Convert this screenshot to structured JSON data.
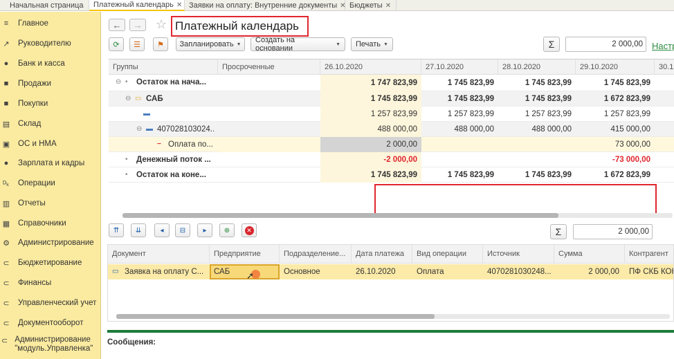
{
  "tabs": [
    {
      "label": "Начальная страница",
      "closable": false
    },
    {
      "label": "Платежный календарь",
      "closable": true
    },
    {
      "label": "Заявки на оплату: Внутренние документы",
      "closable": true
    },
    {
      "label": "Бюджеты",
      "closable": true
    }
  ],
  "sidebar": {
    "items": [
      {
        "label": "Главное",
        "icon": "menu-icon",
        "glyph": "≡"
      },
      {
        "label": "Руководителю",
        "icon": "trend-icon",
        "glyph": "↗"
      },
      {
        "label": "Банк и касса",
        "icon": "coins-icon",
        "glyph": "●"
      },
      {
        "label": "Продажи",
        "icon": "bag-icon",
        "glyph": "■"
      },
      {
        "label": "Покупки",
        "icon": "cart-icon",
        "glyph": "■"
      },
      {
        "label": "Склад",
        "icon": "warehouse-icon",
        "glyph": "▤"
      },
      {
        "label": "ОС и НМА",
        "icon": "assets-icon",
        "glyph": "▣"
      },
      {
        "label": "Зарплата и кадры",
        "icon": "people-icon",
        "glyph": "●"
      },
      {
        "label": "Операции",
        "icon": "dt-kt-icon",
        "glyph": "ᴰₖ"
      },
      {
        "label": "Отчеты",
        "icon": "bar-chart-icon",
        "glyph": "▥"
      },
      {
        "label": "Справочники",
        "icon": "book-icon",
        "glyph": "▦"
      },
      {
        "label": "Администрирование",
        "icon": "gear-icon",
        "glyph": "⚙"
      },
      {
        "label": "Бюджетирование",
        "icon": "link-icon",
        "glyph": "⊂"
      },
      {
        "label": "Финансы",
        "icon": "link-icon",
        "glyph": "⊂"
      },
      {
        "label": "Управленческий учет",
        "icon": "link-icon",
        "glyph": "⊂"
      },
      {
        "label": "Документооборот",
        "icon": "link-icon",
        "glyph": "⊂"
      },
      {
        "label": "Администрирование \"модуль.Управленка\"",
        "icon": "link-icon",
        "glyph": "⊂"
      }
    ]
  },
  "header": {
    "back": "←",
    "forward": "→",
    "star": "☆",
    "title": "Платежный календарь"
  },
  "toolbar": {
    "refresh": "⟳",
    "plan": "Запланировать",
    "create_based": "Создать на основании",
    "print": "Печать",
    "sum_symbol": "Σ",
    "sum_value": "2 000,00",
    "settings_link": "Настр"
  },
  "grid": {
    "headers": [
      "Группы",
      "Просроченные",
      "26.10.2020",
      "27.10.2020",
      "28.10.2020",
      "29.10.2020",
      "30.1"
    ],
    "rows": [
      {
        "label": "Остаток на нача...",
        "bold": true,
        "tree": "⊖ •",
        "values": [
          "1 747 823,99",
          "1 745 823,99",
          "1 745 823,99",
          "1 745 823,99"
        ]
      },
      {
        "label": "САБ",
        "bold": true,
        "tree": "⊖ folder",
        "values": [
          "1 745 823,99",
          "1 745 823,99",
          "1 745 823,99",
          "1 672 823,99"
        ]
      },
      {
        "label": "",
        "bold": false,
        "tree": "minus",
        "values": [
          "1 257 823,99",
          "1 257 823,99",
          "1 257 823,99",
          "1 257 823,99"
        ]
      },
      {
        "label": "407028103024...",
        "bold": false,
        "tree": "⊖ minus",
        "values": [
          "488 000,00",
          "488 000,00",
          "488 000,00",
          "415 000,00"
        ]
      },
      {
        "label": "Оплата по...",
        "bold": false,
        "tree": "red-minus",
        "values": [
          "2 000,00",
          "",
          "",
          "73 000,00"
        ]
      },
      {
        "label": "Денежный поток ...",
        "bold": true,
        "tree": "•",
        "values": [
          "-2 000,00",
          "",
          "",
          "-73 000,00"
        ]
      },
      {
        "label": "Остаток на коне...",
        "bold": true,
        "tree": "•",
        "values": [
          "1 745 823,99",
          "1 745 823,99",
          "1 745 823,99",
          "1 672 823,99"
        ]
      }
    ]
  },
  "lower_toolbar": {
    "sum_symbol": "Σ",
    "sum_value": "2 000,00"
  },
  "doc_grid": {
    "headers": [
      "Документ",
      "Предприятие",
      "Подразделение...",
      "Дата платежа",
      "Вид операции",
      "Источник",
      "Сумма",
      "Контрагент"
    ],
    "row": {
      "document": "Заявка на оплату С...",
      "enterprise": "САБ",
      "department": "Основное",
      "date": "26.10.2020",
      "operation": "Оплата",
      "source": "4070281030248...",
      "amount": "2 000,00",
      "counterparty": "ПФ СКБ КОН"
    }
  },
  "messages_label": "Сообщения:"
}
